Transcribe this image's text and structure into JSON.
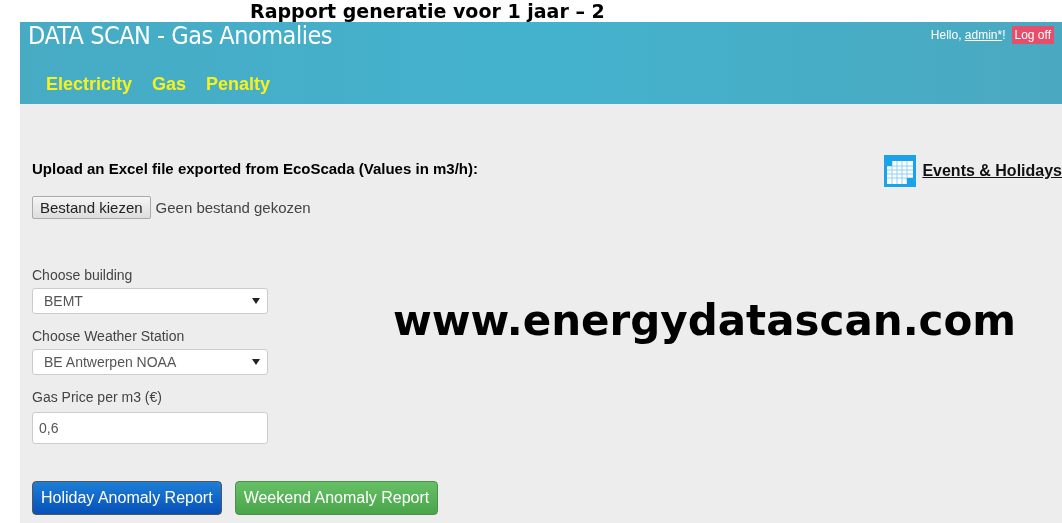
{
  "slide_title": "Rapport generatie voor 1 jaar – 2",
  "app": {
    "title": "DATA SCAN - Gas Anomalies",
    "greeting": "Hello, ",
    "user": "admin*",
    "greeting_end": "!",
    "logoff": "Log off",
    "nav": [
      {
        "label": "Electricity"
      },
      {
        "label": "Gas"
      },
      {
        "label": "Penalty"
      }
    ]
  },
  "upload": {
    "label": "Upload an Excel file exported from EcoScada (Values in m3/h):",
    "button": "Bestand kiezen",
    "status": "Geen bestand gekozen"
  },
  "events_link": "Events & Holidays",
  "fields": [
    {
      "kind": "select",
      "label": "Choose building",
      "value": "BEMT"
    },
    {
      "kind": "select",
      "label": "Choose Weather Station",
      "value": "BE Antwerpen NOAA"
    },
    {
      "kind": "input",
      "label": "Gas Price per m3 (€)",
      "value": "0,6"
    }
  ],
  "buttons": [
    {
      "label": "Holiday Anomaly Report",
      "kind": "primary"
    },
    {
      "label": "Weekend Anomaly Report",
      "kind": "success"
    }
  ],
  "overlay_text": "www.energydatascan.com"
}
